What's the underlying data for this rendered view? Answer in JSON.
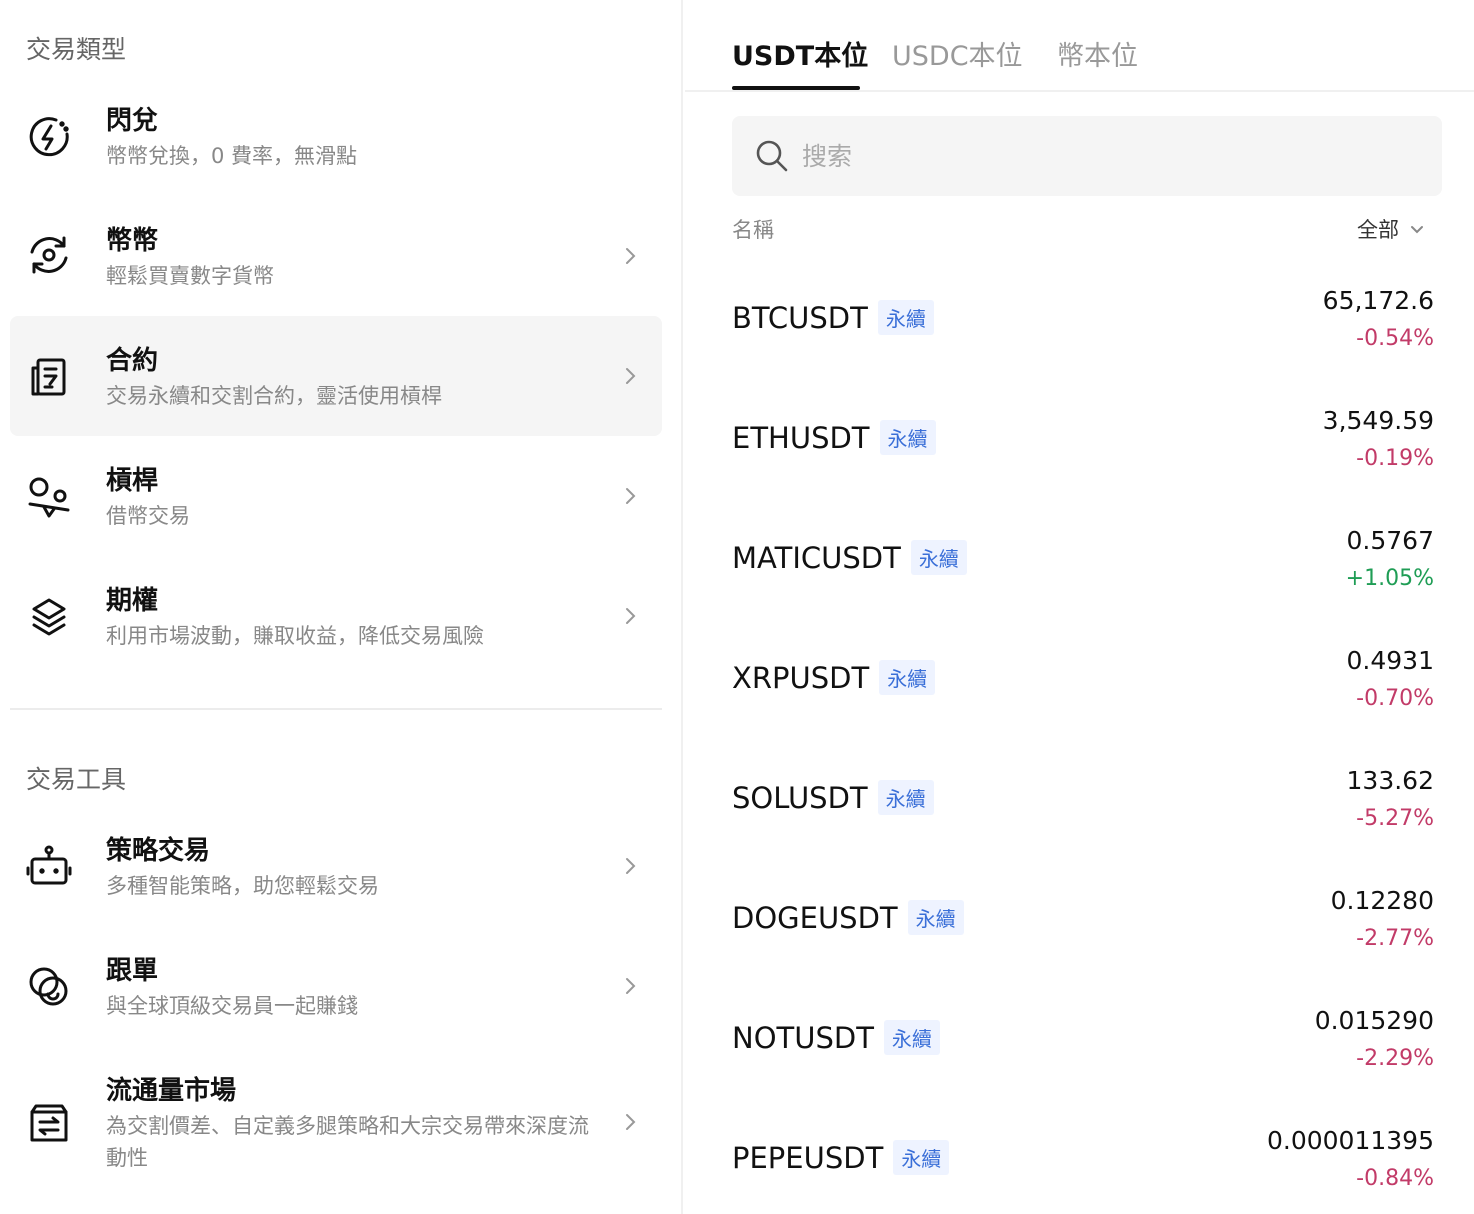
{
  "left": {
    "section1_title": "交易類型",
    "section2_title": "交易工具",
    "items": [
      {
        "title": "閃兌",
        "desc": "幣幣兌換，0 費率，無滑點"
      },
      {
        "title": "幣幣",
        "desc": "輕鬆買賣數字貨幣"
      },
      {
        "title": "合約",
        "desc": "交易永續和交割合約，靈活使用槓桿"
      },
      {
        "title": "槓桿",
        "desc": "借幣交易"
      },
      {
        "title": "期權",
        "desc": "利用市場波動，賺取收益，降低交易風險"
      },
      {
        "title": "策略交易",
        "desc": "多種智能策略，助您輕鬆交易"
      },
      {
        "title": "跟單",
        "desc": "與全球頂級交易員一起賺錢"
      },
      {
        "title": "流通量市場",
        "desc": "為交割價差、自定義多腿策略和大宗交易帶來深度流動性"
      }
    ]
  },
  "right": {
    "tabs": [
      {
        "label": "USDT本位"
      },
      {
        "label": "USDC本位"
      },
      {
        "label": "幣本位"
      }
    ],
    "search_placeholder": "搜索",
    "col_name": "名稱",
    "col_filter": "全部",
    "badge_label": "永續",
    "rows": [
      {
        "symbol": "BTCUSDT",
        "price": "65,172.6",
        "change": "-0.54%"
      },
      {
        "symbol": "ETHUSDT",
        "price": "3,549.59",
        "change": "-0.19%"
      },
      {
        "symbol": "MATICUSDT",
        "price": "0.5767",
        "change": "+1.05%"
      },
      {
        "symbol": "XRPUSDT",
        "price": "0.4931",
        "change": "-0.70%"
      },
      {
        "symbol": "SOLUSDT",
        "price": "133.62",
        "change": "-5.27%"
      },
      {
        "symbol": "DOGEUSDT",
        "price": "0.12280",
        "change": "-2.77%"
      },
      {
        "symbol": "NOTUSDT",
        "price": "0.015290",
        "change": "-2.29%"
      },
      {
        "symbol": "PEPEUSDT",
        "price": "0.000011395",
        "change": "-0.84%"
      }
    ]
  },
  "colors": {
    "negative": "#c23b68",
    "positive": "#1f9d55",
    "badge_text": "#3a6fd8",
    "badge_bg": "#eef3ff"
  }
}
